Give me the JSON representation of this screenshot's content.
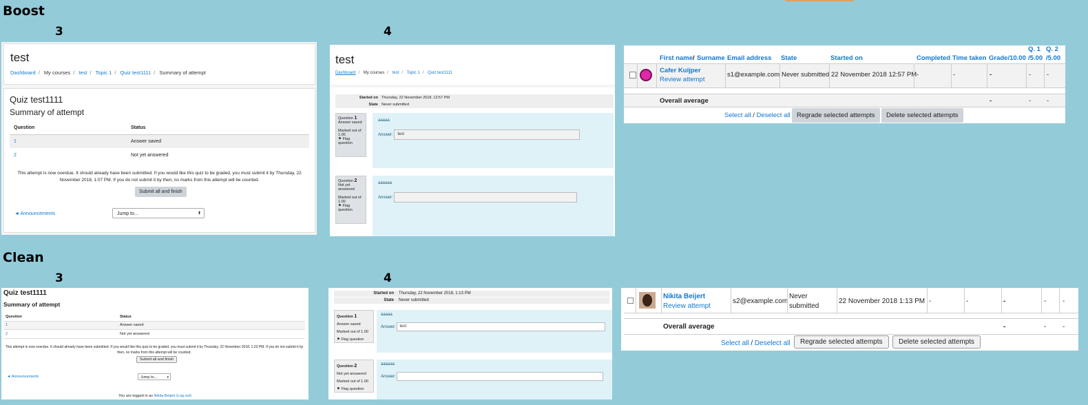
{
  "sections": {
    "boost": "Boost",
    "clean": "Clean",
    "three": "3",
    "four": "4"
  },
  "boost3": {
    "title": "test",
    "breadcrumb": [
      "Dashboard",
      "My courses",
      "test",
      "Topic 1",
      "Quiz test1111",
      "Summary of attempt"
    ],
    "quiz_name": "Quiz test1111",
    "summary_heading": "Summary of attempt",
    "col_question": "Question",
    "col_status": "Status",
    "rows": [
      {
        "q": "1",
        "status": "Answer saved"
      },
      {
        "q": "2",
        "status": "Not yet answered"
      }
    ],
    "overdue_text": "This attempt is now overdue. It should already have been submitted. If you would like this quiz to be graded, you must submit it by Thursday, 22 November 2018, 1:07 PM. If you do not submit it by then, no marks from this attempt will be counted.",
    "submit_button": "Submit all and finish",
    "announcements_link": "◄ Announcements",
    "jump_to": "Jump to..."
  },
  "boost4": {
    "title": "test",
    "breadcrumb": [
      "Dashboard",
      "My courses",
      "test",
      "Topic 1",
      "Quiz test1111"
    ],
    "started_on_label": "Started on",
    "started_on_value": "Thursday, 22 November 2018, 12:57 PM",
    "state_label": "State",
    "state_value": "Never submitted",
    "questions": [
      {
        "label": "Question",
        "num": "1",
        "status": "Answer saved",
        "marked": "Marked out of 1.00",
        "flag": "Flag question",
        "text": "aaaaa",
        "answer_label": "Answer:",
        "answer": "test"
      },
      {
        "label": "Question",
        "num": "2",
        "status": "Not yet answered",
        "marked": "Marked out of 1.00",
        "flag": "Flag question",
        "text": "aaaaaa",
        "answer_label": "Answer:",
        "answer": ""
      }
    ]
  },
  "boost_report": {
    "headers": {
      "first_name": "First name",
      "slash": " / ",
      "surname": "Surname",
      "email": "Email address",
      "state": "State",
      "started": "Started on",
      "completed": "Completed",
      "time_taken": "Time taken",
      "grade": "Grade/10.00",
      "q1a": "Q. 1",
      "q1b": "/5.00",
      "q2a": "Q. 2",
      "q2b": "/5.00"
    },
    "row": {
      "name": "Cafer Kuijper",
      "review": "Review attempt",
      "email": "s1@example.com",
      "state": "Never submitted",
      "started": "22 November 2018 12:57 PM",
      "completed": "-",
      "time_taken": "-",
      "grade": "-",
      "q1": "-",
      "q2": "-"
    },
    "overall": {
      "label": "Overall average",
      "grade": "-",
      "q1": "-",
      "q2": "-"
    },
    "select_all": "Select all",
    "deselect_all": "Deselect all",
    "regrade_button": "Regrade selected attempts",
    "delete_button": "Delete selected attempts"
  },
  "clean3": {
    "quiz_name": "Quiz test1111",
    "summary_heading": "Summary of attempt",
    "col_question": "Question",
    "col_status": "Status",
    "rows": [
      {
        "q": "1",
        "status": "Answer saved"
      },
      {
        "q": "2",
        "status": "Not yet answered"
      }
    ],
    "overdue_text": "This attempt is now overdue. It should already have been submitted. If you would like this quiz to be graded, you must submit it by Thursday, 22 November 2018, 1:23 PM. If you do not submit it by then, no marks from this attempt will be counted.",
    "submit_button": "Submit all and finish",
    "announcements_link": "◄ Announcements",
    "jump_to": "Jump to...",
    "logged_in_prefix": "You are logged in as",
    "logged_in_user": "Nikita Beijert",
    "logout": "(Log out)"
  },
  "clean4": {
    "started_on_label": "Started on",
    "started_on_value": "Thursday, 22 November 2018, 1:13 PM",
    "state_label": "State",
    "state_value": "Never submitted",
    "questions": [
      {
        "label": "Question",
        "num": "1",
        "status": "Answer saved",
        "marked": "Marked out of 1.00",
        "flag": "Flag question",
        "text": "aaaaa",
        "answer_label": "Answer:",
        "answer": "test"
      },
      {
        "label": "Question",
        "num": "2",
        "status": "Not yet answered",
        "marked": "Marked out of 1.00",
        "flag": "Flag question",
        "text": "aaaaaa",
        "answer_label": "Answer:",
        "answer": ""
      }
    ]
  },
  "clean_report": {
    "row": {
      "name": "Nikita Beijert",
      "review": "Review attempt",
      "email": "s2@example.com",
      "state_line1": "Never",
      "state_line2": "submitted",
      "started": "22 November 2018 1:13 PM",
      "completed": "-",
      "time_taken": "-",
      "grade": "-",
      "q1": "-",
      "q2": "-"
    },
    "overall": {
      "label": "Overall average",
      "grade": "-",
      "q1": "-",
      "q2": "-"
    },
    "select_all": "Select all",
    "deselect_all": "Deselect all",
    "regrade_button": "Regrade selected attempts",
    "delete_button": "Delete selected attempts"
  }
}
